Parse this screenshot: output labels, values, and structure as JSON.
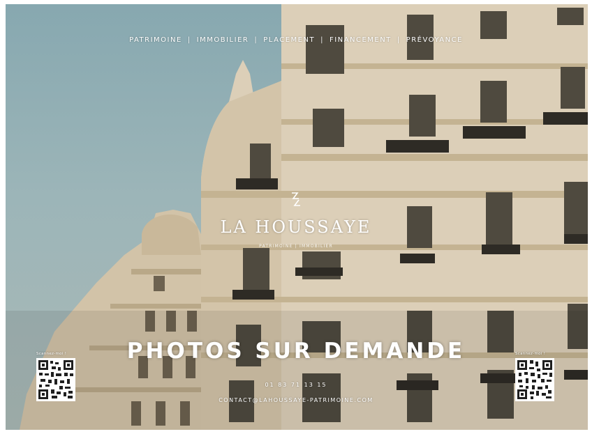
{
  "nav": {
    "items": [
      "PATRIMOINE",
      "IMMOBILIER",
      "PLACEMENT",
      "FINANCEMENT",
      "PRÉVOYANCE"
    ],
    "separator": "|"
  },
  "brand": {
    "logo_icon": "la-houssaye-logo-mark",
    "name": "LA HOUSSAYE",
    "tagline": "PATRIMOINE | IMMOBILIER"
  },
  "headline": "PHOTOS SUR DEMANDE",
  "contact": {
    "phone": "01 83 71 13 15",
    "email": "CONTACT@LAHOUSSAYE-PATRIMOINE.COM"
  },
  "qr_codes": {
    "left_label": "Scannez-moi !",
    "right_label": "Scannez-moi !"
  },
  "colors": {
    "sky": "#8fadb3",
    "facade": "#d8ccb7",
    "text": "#ffffff"
  }
}
